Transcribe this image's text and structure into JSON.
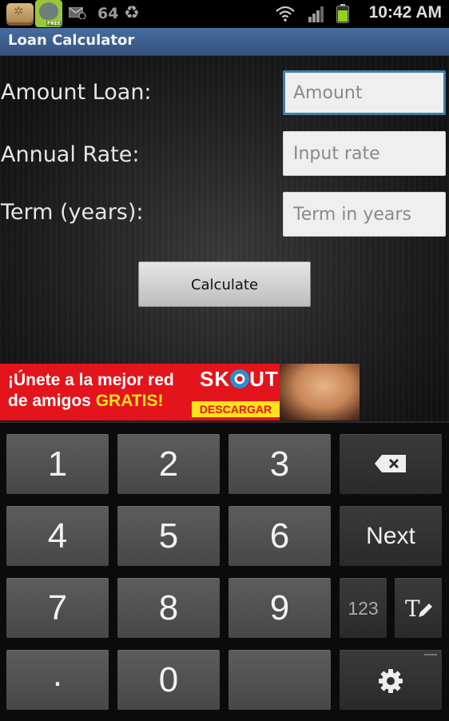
{
  "status_bar": {
    "notification_icons": [
      "mahjong-app-icon",
      "talking-tom-free-icon",
      "email-icon",
      "recycle-icon"
    ],
    "free_badge": "FREE",
    "notification_count": "64",
    "time": "10:42 AM",
    "battery_color": "#8fd21a"
  },
  "titlebar": {
    "title": "Loan Calculator",
    "color": "#3e5f8e"
  },
  "form": {
    "fields": [
      {
        "label": "Amount Loan:",
        "placeholder": "Amount",
        "value": "",
        "focused": true
      },
      {
        "label": "Annual Rate:",
        "placeholder": "Input rate",
        "value": "",
        "focused": false
      },
      {
        "label": "Term (years):",
        "placeholder": "Term in years",
        "value": "",
        "focused": false
      }
    ],
    "calculate_label": "Calculate"
  },
  "ad": {
    "line1": "¡Únete a la mejor red",
    "line2_prefix": "de amigos ",
    "line2_highlight": "GRATIS!",
    "brand_left": "SK",
    "brand_right": "UT",
    "cta": "DESCARGAR",
    "background": "#e4141c"
  },
  "keyboard": {
    "rows": [
      [
        "1",
        "2",
        "3",
        "backspace-icon"
      ],
      [
        "4",
        "5",
        "6",
        "Next"
      ],
      [
        "7",
        "8",
        "9",
        "123",
        "text-edit-icon"
      ],
      [
        ".",
        "0",
        "",
        "settings-icon"
      ]
    ],
    "keys": {
      "k1": "1",
      "k2": "2",
      "k3": "3",
      "k4": "4",
      "k5": "5",
      "k6": "6",
      "k7": "7",
      "k8": "8",
      "k9": "9",
      "kdot": ".",
      "k0": "0",
      "next": "Next",
      "mode": "123"
    }
  }
}
